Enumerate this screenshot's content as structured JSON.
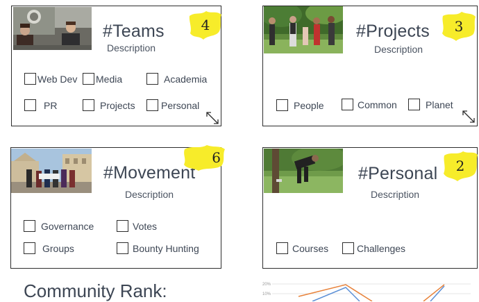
{
  "cards": [
    {
      "id": "teams",
      "title": "#Teams",
      "description": "Description",
      "badge": "4",
      "options": [
        "Web Dev",
        "Media",
        "Academia",
        "PR",
        "Projects",
        "Personal"
      ]
    },
    {
      "id": "projects",
      "title": "#Projects",
      "description": "Description",
      "badge": "3",
      "options": [
        "People",
        "Common",
        "Planet"
      ]
    },
    {
      "id": "movement",
      "title": "#Movement",
      "description": "Description",
      "badge": "6",
      "options": [
        "Governance",
        "Votes",
        "Groups",
        "Bounty Hunting"
      ]
    },
    {
      "id": "personal",
      "title": "#Personal",
      "description": "Description",
      "badge": "2",
      "options": [
        "Courses",
        "Challenges"
      ]
    }
  ],
  "community_rank": {
    "label": "Community Rank:"
  },
  "mini_chart": {
    "y_ticks": [
      "20%",
      "10%"
    ],
    "series_colors": [
      "#e8823a",
      "#5b8fd6"
    ]
  },
  "colors": {
    "badge_yellow": "#f7ec2a",
    "border": "#2d2d2d",
    "text": "#3d4654"
  }
}
